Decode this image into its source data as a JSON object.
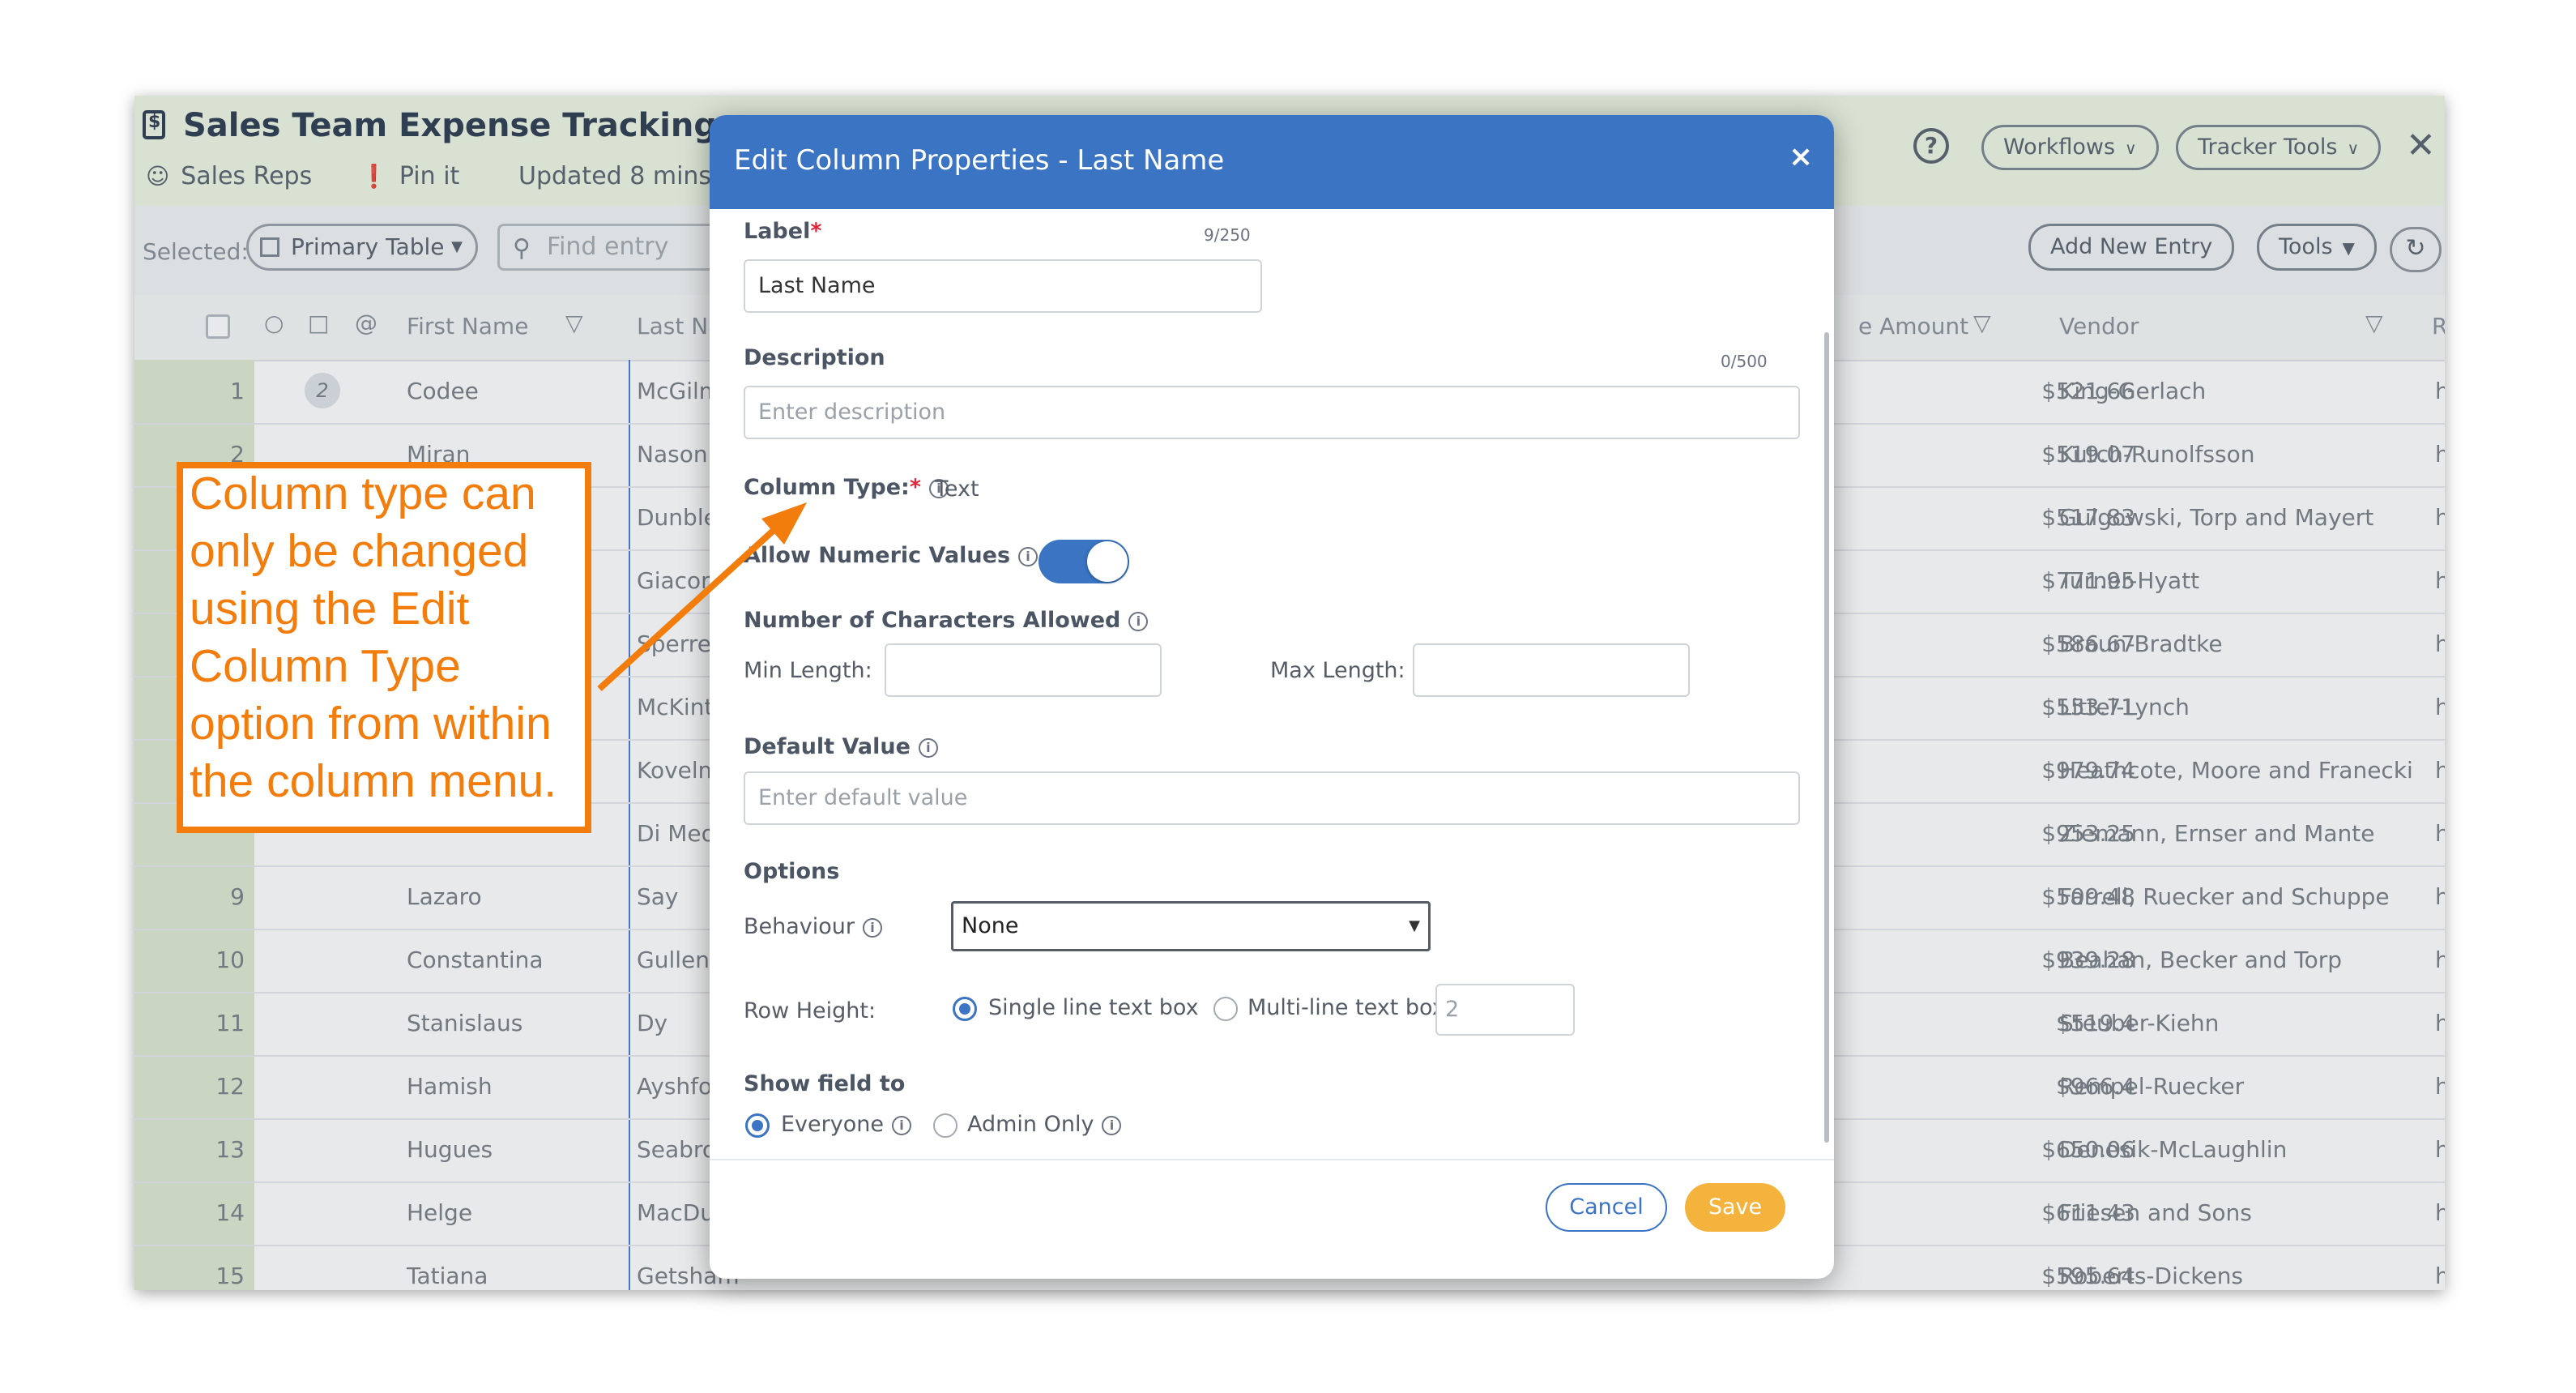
{
  "app": {
    "title": "Sales Team Expense Tracking",
    "meta_reps": "Sales Reps",
    "meta_pin": "Pin it",
    "meta_updated": "Updated 8 mins",
    "workflows_label": "Workflows",
    "tracker_tools_label": "Tracker Tools",
    "close_glyph": "✕",
    "help_glyph": "?"
  },
  "toolbar": {
    "selected_label": "Selected:",
    "table_select_value": "Primary Table",
    "search_placeholder": "Find entry",
    "add_entry_label": "Add New Entry",
    "tools_label": "Tools"
  },
  "grid": {
    "headers": [
      "First Name",
      "Last Na",
      "e Amount",
      "Vendor",
      "R"
    ],
    "rows": [
      {
        "num": "1",
        "first": "Codee",
        "last": "McGilm",
        "amount": "$521.66",
        "vendor": "King-Gerlach",
        "r": "ht"
      },
      {
        "num": "2",
        "first": "Miran",
        "last": "Nason",
        "amount": "$519.07",
        "vendor": "Kutch-Runolfsson",
        "r": "ht"
      },
      {
        "num": "",
        "first": "",
        "last": "Dunble",
        "amount": "$517.83",
        "vendor": "Gulgowski, Torp and Mayert",
        "r": "ht"
      },
      {
        "num": "",
        "first": "",
        "last": "Giacon",
        "amount": "$771.95",
        "vendor": "Turner-Hyatt",
        "r": "ht"
      },
      {
        "num": "",
        "first": "",
        "last": "Sperrea",
        "amount": "$586.67",
        "vendor": "Braun-Bradtke",
        "r": "ht"
      },
      {
        "num": "",
        "first": "",
        "last": "McKint",
        "amount": "$553.71",
        "vendor": "Littel-Lynch",
        "r": "ht"
      },
      {
        "num": "",
        "first": "",
        "last": "Kovelm",
        "amount": "$979.74",
        "vendor": "Heathcote, Moore and Franecki",
        "r": "ht"
      },
      {
        "num": "",
        "first": "",
        "last": "Di Meo",
        "amount": "$953.25",
        "vendor": "Ziemann, Ernser and Mante",
        "r": "ht"
      },
      {
        "num": "9",
        "first": "Lazaro",
        "last": "Say",
        "amount": "$509.48",
        "vendor": "Farrell, Ruecker and Schuppe",
        "r": "ht"
      },
      {
        "num": "10",
        "first": "Constantina",
        "last": "Gullen",
        "amount": "$939.28",
        "vendor": "Beahan, Becker and Torp",
        "r": "ht"
      },
      {
        "num": "11",
        "first": "Stanislaus",
        "last": "Dy",
        "amount": "$519.4",
        "vendor": "Steuber-Kiehn",
        "r": "ht"
      },
      {
        "num": "12",
        "first": "Hamish",
        "last": "Ayshfo",
        "amount": "$966.4",
        "vendor": "Rempel-Ruecker",
        "r": "ht"
      },
      {
        "num": "13",
        "first": "Hugues",
        "last": "Seabro",
        "amount": "$650.06",
        "vendor": "Denesik-McLaughlin",
        "r": "ht"
      },
      {
        "num": "14",
        "first": "Helge",
        "last": "MacDu",
        "amount": "$611.43",
        "vendor": "Friesen and Sons",
        "r": "ht"
      },
      {
        "num": "15",
        "first": "Tatiana",
        "last": "Getsham",
        "amount": "$595.64",
        "vendor": "Roberts-Dickens",
        "r": "ht"
      }
    ],
    "row1_badge": "2"
  },
  "modal": {
    "title": "Edit Column Properties - Last Name",
    "close_glyph": "×",
    "label_label": "Label",
    "label_counter": "9/250",
    "label_value": "Last Name",
    "description_label": "Description",
    "description_counter": "0/500",
    "description_placeholder": "Enter description",
    "column_type_label": "Column Type:",
    "column_type_value": "Text",
    "allow_numeric_label": "Allow Numeric Values",
    "allow_numeric_on": true,
    "chars_allowed_label": "Number of Characters Allowed",
    "min_length_label": "Min Length:",
    "max_length_label": "Max Length:",
    "default_value_label": "Default Value",
    "default_value_placeholder": "Enter default value",
    "options_label": "Options",
    "behaviour_label": "Behaviour",
    "behaviour_value": "None",
    "row_height_label": "Row Height:",
    "single_line_label": "Single line text box",
    "multi_line_label": "Multi-line text box",
    "multi_line_value": "2",
    "show_field_label": "Show field to",
    "everyone_label": "Everyone",
    "admin_only_label": "Admin Only",
    "cancel_label": "Cancel",
    "save_label": "Save",
    "info_glyph": "i",
    "required_mark": "*"
  },
  "callout": {
    "lines": [
      "Column type can",
      "only be changed",
      "using the Edit",
      "Column Type",
      "option from within",
      "the column menu."
    ]
  },
  "colors": {
    "modal_header": "#3a74c3",
    "save_button": "#f3b33d",
    "callout_orange": "#f27d0c",
    "header_green": "#eef6e4"
  }
}
